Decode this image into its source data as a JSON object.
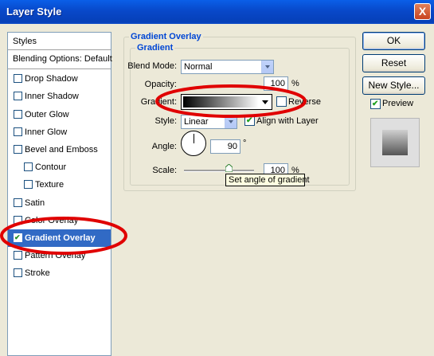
{
  "window": {
    "title": "Layer Style",
    "close_glyph": "X"
  },
  "styles_list": {
    "header": "Styles",
    "blending": "Blending Options: Default",
    "items": [
      {
        "label": "Drop Shadow",
        "checked": false
      },
      {
        "label": "Inner Shadow",
        "checked": false
      },
      {
        "label": "Outer Glow",
        "checked": false
      },
      {
        "label": "Inner Glow",
        "checked": false
      },
      {
        "label": "Bevel and Emboss",
        "checked": false
      },
      {
        "label": "Contour",
        "checked": false
      },
      {
        "label": "Texture",
        "checked": false
      },
      {
        "label": "Satin",
        "checked": false
      },
      {
        "label": "Color Overlay",
        "checked": false
      },
      {
        "label": "Gradient Overlay",
        "checked": true
      },
      {
        "label": "Pattern Overlay",
        "checked": false
      },
      {
        "label": "Stroke",
        "checked": false
      }
    ]
  },
  "panel": {
    "group_title": "Gradient Overlay",
    "subgroup_title": "Gradient",
    "blend_mode_label": "Blend Mode:",
    "blend_mode_value": "Normal",
    "opacity_label": "Opacity:",
    "opacity_value": "100",
    "opacity_unit": "%",
    "gradient_label": "Gradient:",
    "reverse_label": "Reverse",
    "style_label": "Style:",
    "style_value": "Linear",
    "align_label": "Align with Layer",
    "angle_label": "Angle:",
    "angle_value": "90",
    "angle_unit": "°",
    "scale_label": "Scale:",
    "scale_value": "100",
    "scale_unit": "%",
    "tooltip": "Set angle of gradient"
  },
  "buttons": {
    "ok": "OK",
    "reset": "Reset",
    "new_style": "New Style...",
    "preview_label": "Preview"
  },
  "colors": {
    "titlebar": "#0a5fe8",
    "selection": "#316ac5",
    "annotation": "#e00000",
    "group_title": "#0046d5"
  },
  "icons": {
    "close": "close-icon",
    "check": "checkmark-icon",
    "dropdown": "chevron-down-icon",
    "dial": "angle-dial-icon",
    "slider": "slider-thumb-icon"
  }
}
